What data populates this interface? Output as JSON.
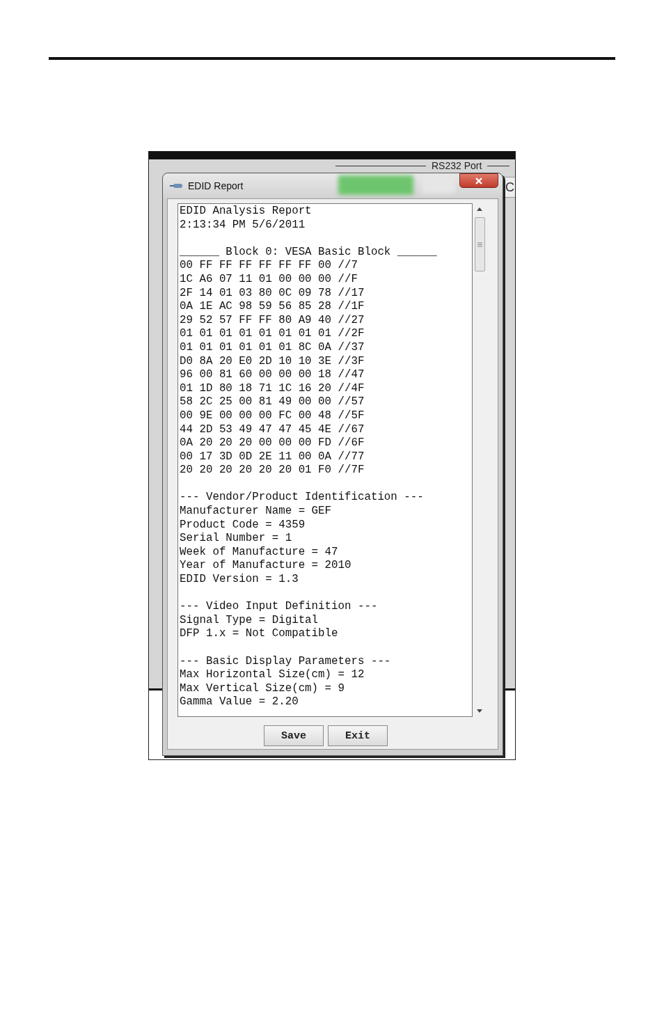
{
  "background_window": {
    "group_label": "RS232 Port",
    "button_label": "C"
  },
  "dialog": {
    "title": "EDID Report",
    "report": {
      "header": [
        "EDID Analysis Report",
        "2:13:34 PM 5/6/2011"
      ],
      "block_title": "______ Block 0: VESA Basic Block ______",
      "hex_rows": [
        "00 FF FF FF FF FF FF 00 //7",
        "1C A6 07 11 01 00 00 00 //F",
        "2F 14 01 03 80 0C 09 78 //17",
        "0A 1E AC 98 59 56 85 28 //1F",
        "29 52 57 FF FF 80 A9 40 //27",
        "01 01 01 01 01 01 01 01 //2F",
        "01 01 01 01 01 01 8C 0A //37",
        "D0 8A 20 E0 2D 10 10 3E //3F",
        "96 00 81 60 00 00 00 18 //47",
        "01 1D 80 18 71 1C 16 20 //4F",
        "58 2C 25 00 81 49 00 00 //57",
        "00 9E 00 00 00 FC 00 48 //5F",
        "44 2D 53 49 47 47 45 4E //67",
        "0A 20 20 20 00 00 00 FD //6F",
        "00 17 3D 0D 2E 11 00 0A //77",
        "20 20 20 20 20 20 01 F0 //7F"
      ],
      "sections": [
        {
          "title": "--- Vendor/Product Identification ---",
          "lines": [
            "Manufacturer Name = GEF",
            "Product Code = 4359",
            "Serial Number = 1",
            "Week of Manufacture = 47",
            "Year of Manufacture = 2010",
            "EDID Version = 1.3"
          ]
        },
        {
          "title": "--- Video Input Definition ---",
          "lines": [
            "Signal Type = Digital",
            "DFP 1.x = Not Compatible"
          ]
        },
        {
          "title": "--- Basic Display Parameters ---",
          "lines": [
            "Max Horizontal Size(cm) = 12",
            "Max Vertical Size(cm) = 9",
            "Gamma Value = 2.20"
          ]
        }
      ]
    },
    "buttons": [
      {
        "label": "Save"
      },
      {
        "label": "Exit"
      }
    ]
  }
}
